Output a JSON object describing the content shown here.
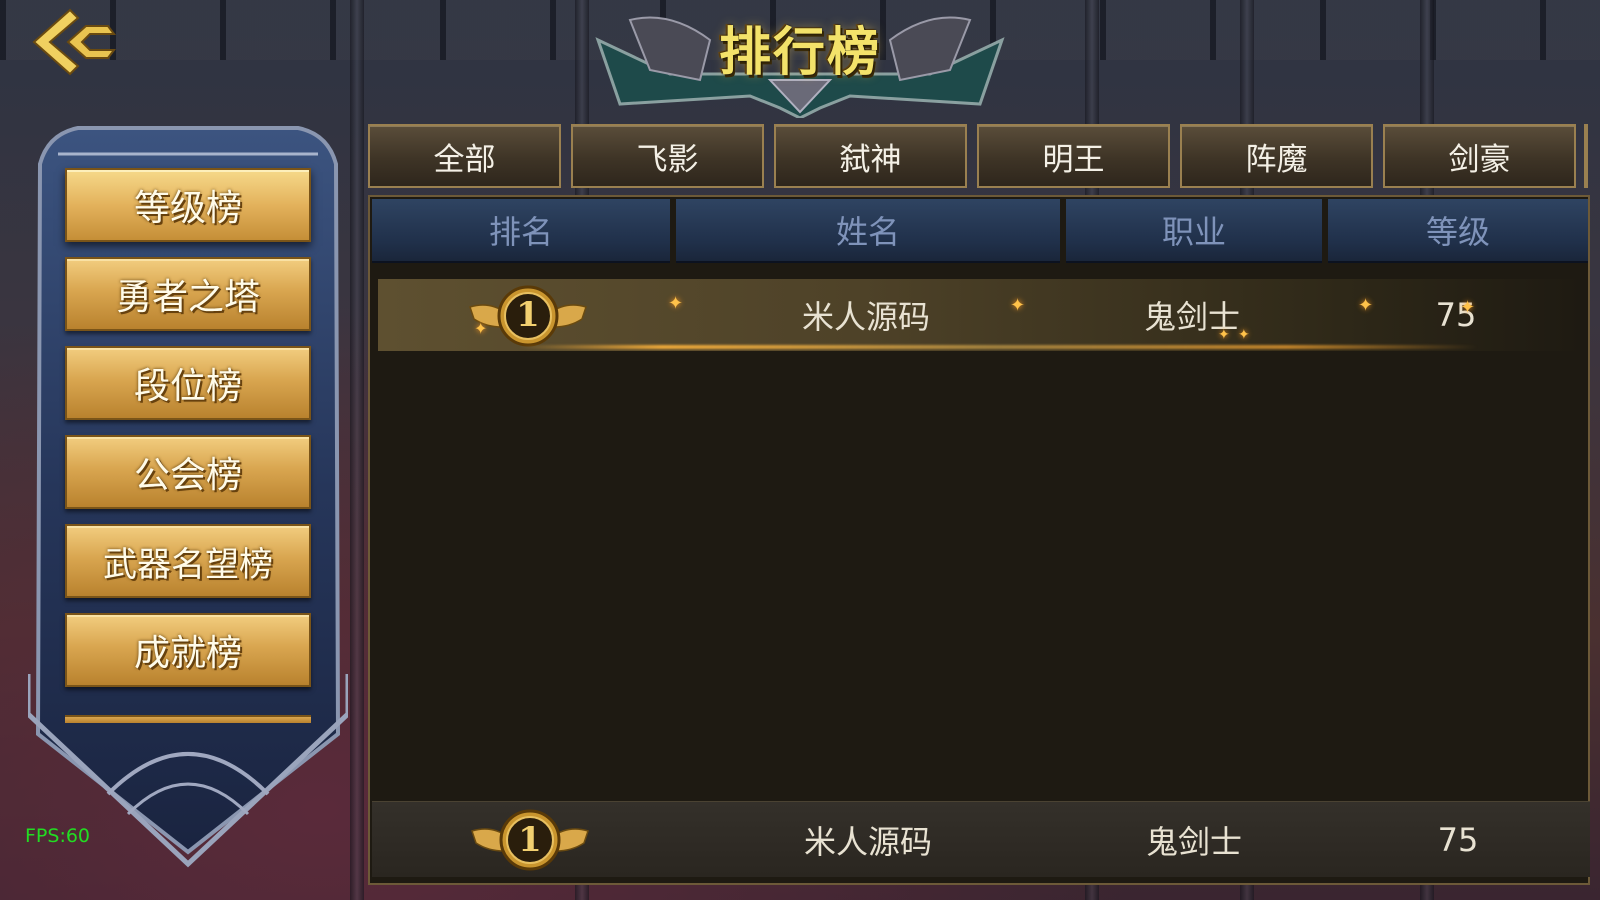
{
  "title": "排行榜",
  "side_menu": {
    "items": [
      {
        "label": "等级榜",
        "active": true
      },
      {
        "label": "勇者之塔",
        "active": false
      },
      {
        "label": "段位榜",
        "active": false
      },
      {
        "label": "公会榜",
        "active": false
      },
      {
        "label": "武器名望榜",
        "active": false
      },
      {
        "label": "成就榜",
        "active": false
      }
    ]
  },
  "tabs": [
    "全部",
    "飞影",
    "弑神",
    "明王",
    "阵魔",
    "剑豪"
  ],
  "table": {
    "headers": [
      "排名",
      "姓名",
      "职业",
      "等级"
    ],
    "rows": [
      {
        "rank": "1",
        "name": "米人源码",
        "class": "鬼剑士",
        "level": "75"
      }
    ]
  },
  "my_rank": {
    "rank": "1",
    "name": "米人源码",
    "class": "鬼剑士",
    "level": "75"
  },
  "fps": "FPS:60",
  "colors": {
    "gold": "#d9a650",
    "header_blue": "#2f4462",
    "header_text": "#7f93ba",
    "fps_green": "#22dd22"
  }
}
